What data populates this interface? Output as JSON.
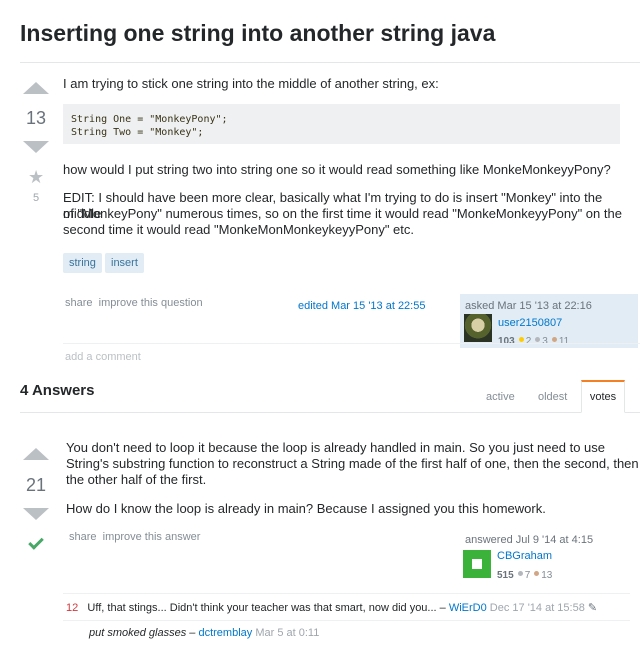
{
  "question": {
    "title": "Inserting one string into another string java",
    "votes": "13",
    "favorites": "5",
    "paragraphs": [
      "I am trying to stick one string into the middle of another string, ex:",
      "how would I put string two into string one so it would read something like MonkeMonkeyyPony?",
      "EDIT: I should have been more clear, basically what I'm trying to do is insert \"Monkey\" into the middle",
      "of \"MonkeyPony\" numerous times, so on the first time it would read \"MonkeMonkeyyPony\" on the",
      "second time it would read \"MonkeMonMonkeykeyyPony\" etc."
    ],
    "code_lines": [
      "String One = \"MonkeyPony\";",
      "String Two = \"Monkey\";"
    ],
    "tags": [
      "string",
      "insert"
    ],
    "menu": "share  improve this question",
    "edited": "edited Mar 15 '13 at 22:55",
    "asked": "asked Mar 15 '13 at 22:16",
    "user": {
      "name": "user2150807",
      "rep": "103",
      "gold": "2",
      "silver": "3",
      "bronze": "11"
    },
    "add_comment": "add a comment"
  },
  "answers_header": "4 Answers",
  "sort_tabs": {
    "active": "active",
    "oldest": "oldest",
    "votes": "votes"
  },
  "answer": {
    "votes": "21",
    "paragraphs": [
      "You don't need to loop it because the loop is already handled in main. So you just need to use",
      "String's substring function to reconstruct a String made of the first half of one, then the second, then",
      "the other half of the first.",
      "How do I know the loop is already in main? Because I assigned you this homework."
    ],
    "menu": "share  improve this answer",
    "answered": "answered Jul 9 '14 at 4:15",
    "user": {
      "name": "CBGraham",
      "rep": "515",
      "silver": "7",
      "bronze": "13"
    },
    "comments": [
      {
        "score": "12",
        "text": "Uff, that stings... Didn't think your teacher was that smart, now did you... –",
        "user": "WiErD0",
        "date": "Dec 17 '14 at 15:58",
        "edit_icon": "pencil-icon"
      },
      {
        "score": "",
        "text": "put smoked glasses –",
        "user": "dctremblay",
        "date": "Mar 5 at 0:11"
      }
    ]
  },
  "colors": {
    "link": "#0077cc",
    "accept": "#48a868",
    "accent": "#f48024",
    "tag_bg": "#e1ecf4"
  }
}
